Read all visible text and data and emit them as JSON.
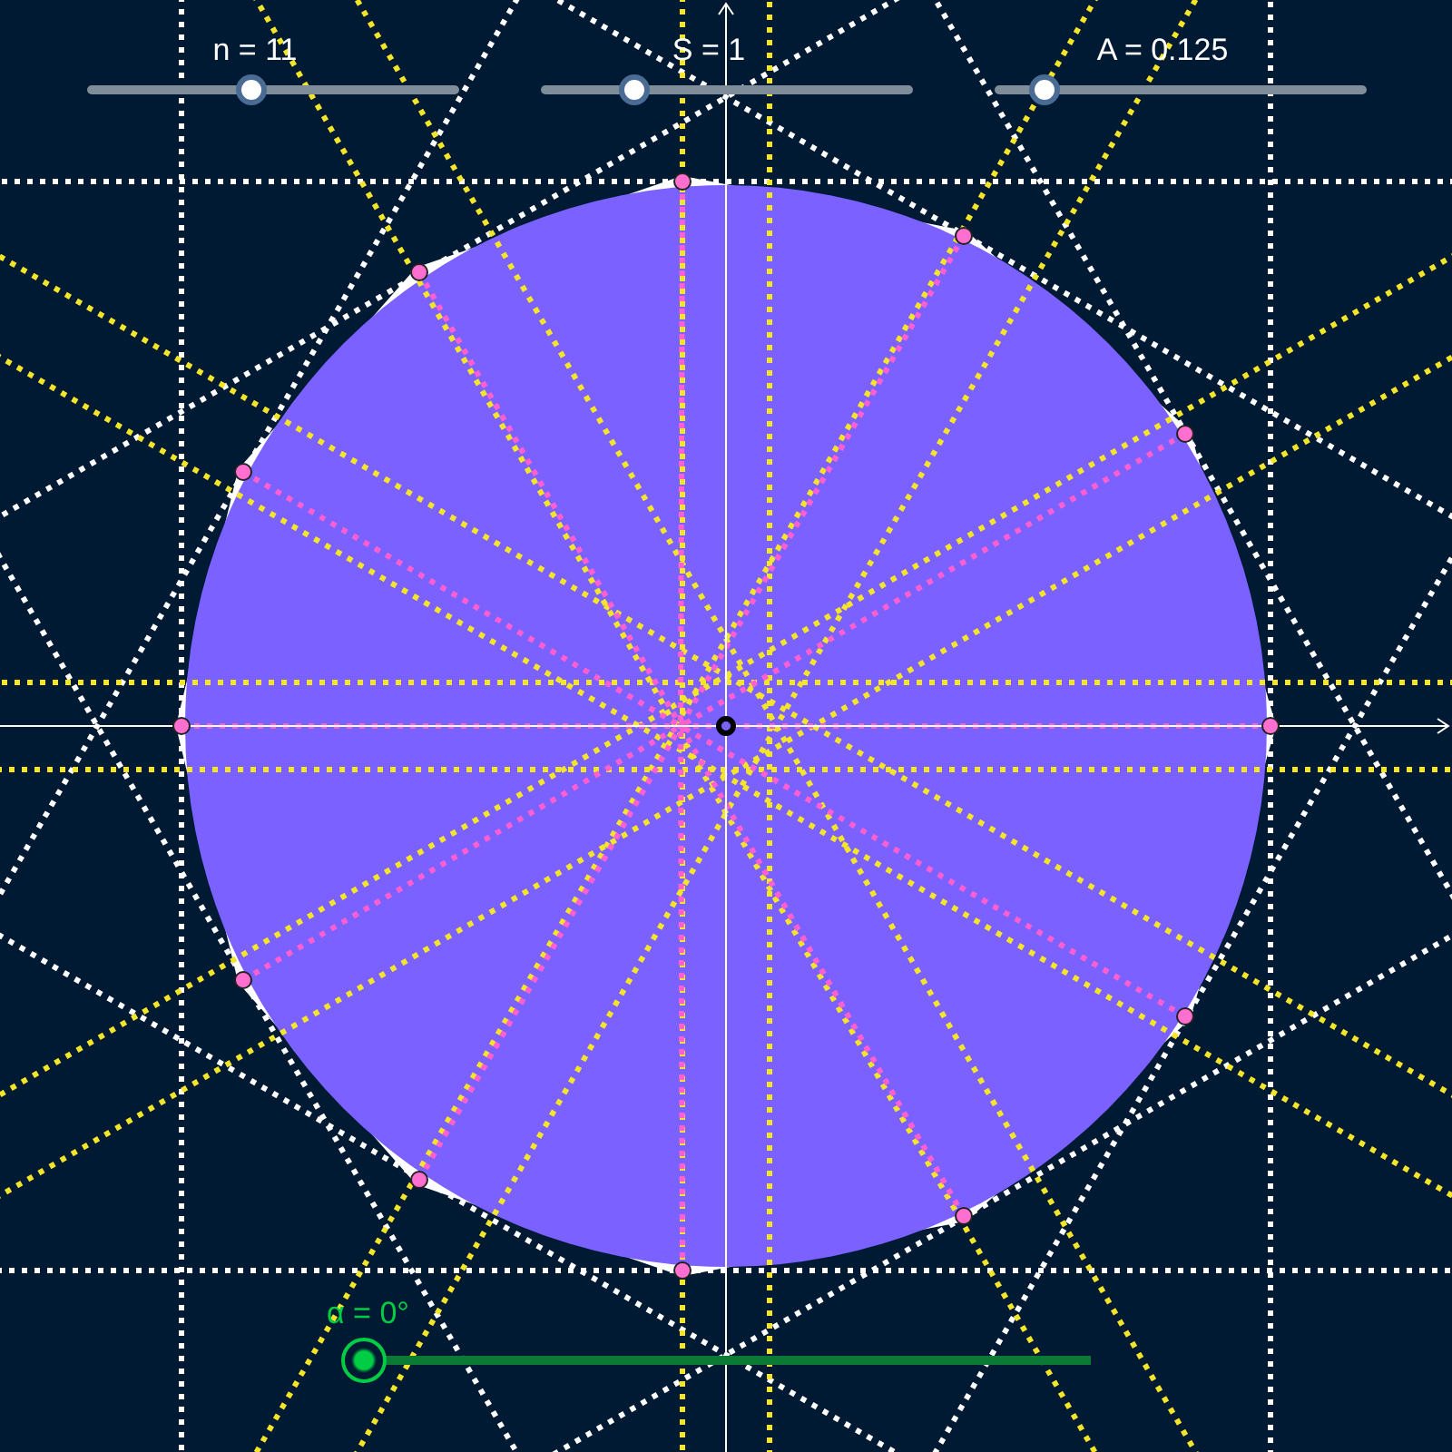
{
  "sliders": [
    {
      "label": "n = 11",
      "level": 0.44
    },
    {
      "label": "S = 1",
      "level": 0.25
    },
    {
      "label": "A = 0.125",
      "level": 0.13
    }
  ],
  "angle_slider": {
    "label": "α = 0°",
    "level": 0
  }
}
